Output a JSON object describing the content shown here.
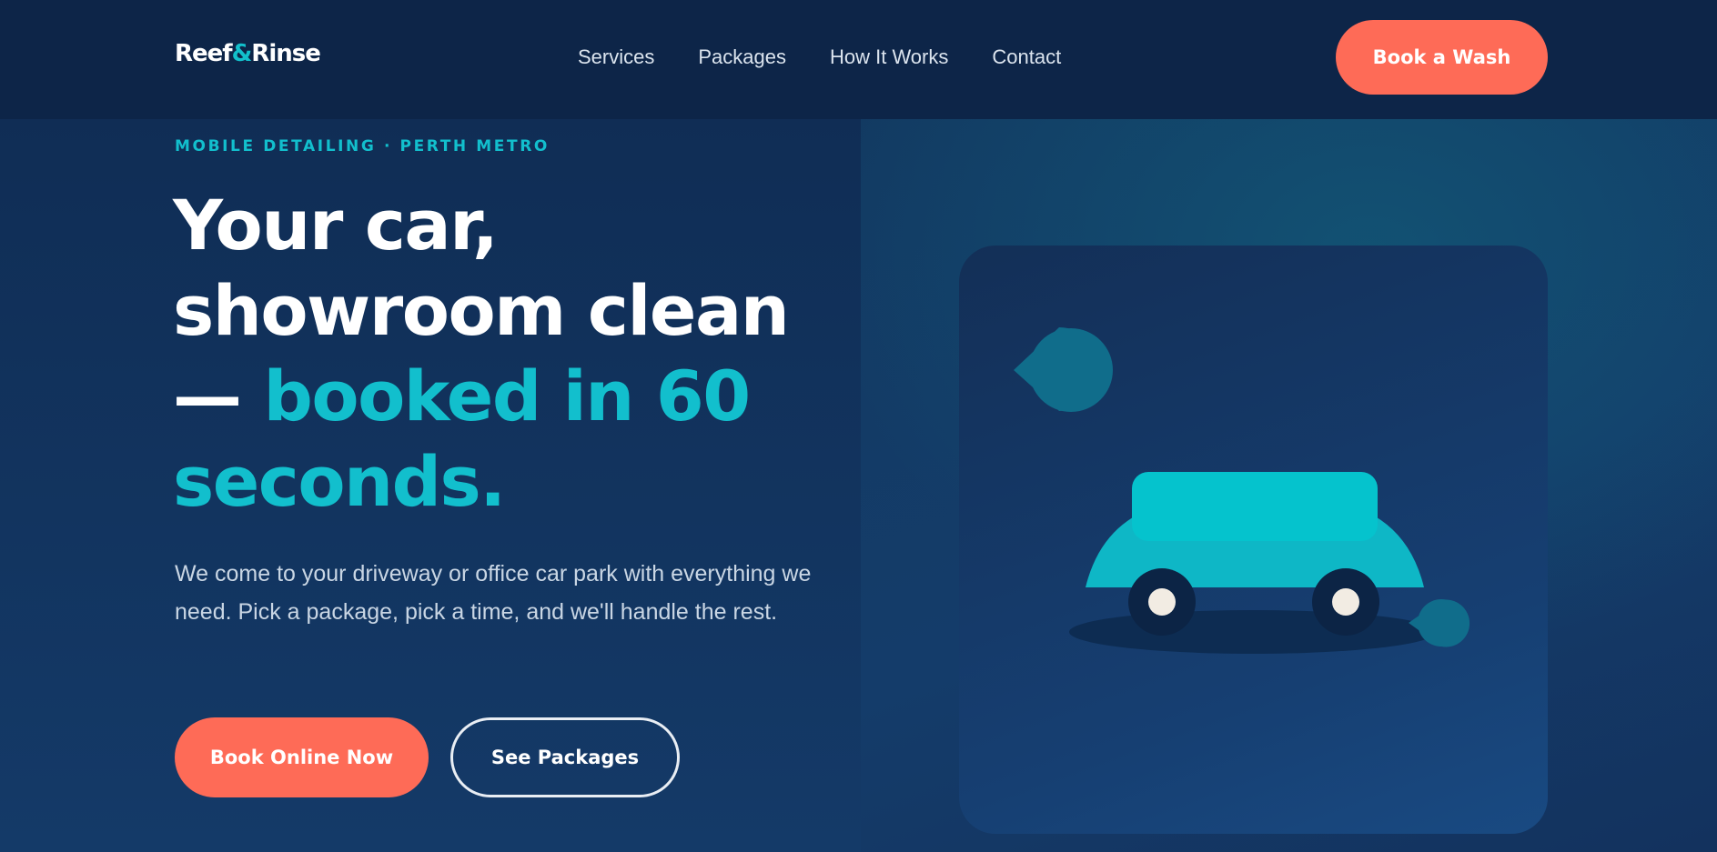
{
  "header": {
    "logo_part1": "Reef",
    "logo_amp": "&",
    "logo_part2": "Rinse",
    "nav": [
      "Services",
      "Packages",
      "How It Works",
      "Contact"
    ],
    "cta_label": "Book a Wash"
  },
  "hero": {
    "eyebrow": "MOBILE DETAILING · PERTH METRO",
    "headline_white": "Your car, showroom clean —",
    "headline_accent": "booked in 60 seconds.",
    "subtext": "We come to your driveway or office car park with everything we need. Pick a package, pick a time, and we'll handle the rest.",
    "primary_button": "Book Online Now",
    "secondary_button": "See Packages"
  },
  "illustration": {
    "icons": [
      "water-drop-icon",
      "car-icon",
      "water-drop-icon"
    ]
  },
  "colors": {
    "navy": "#0d2548",
    "teal": "#12bfcd",
    "coral": "#fe6b57"
  }
}
